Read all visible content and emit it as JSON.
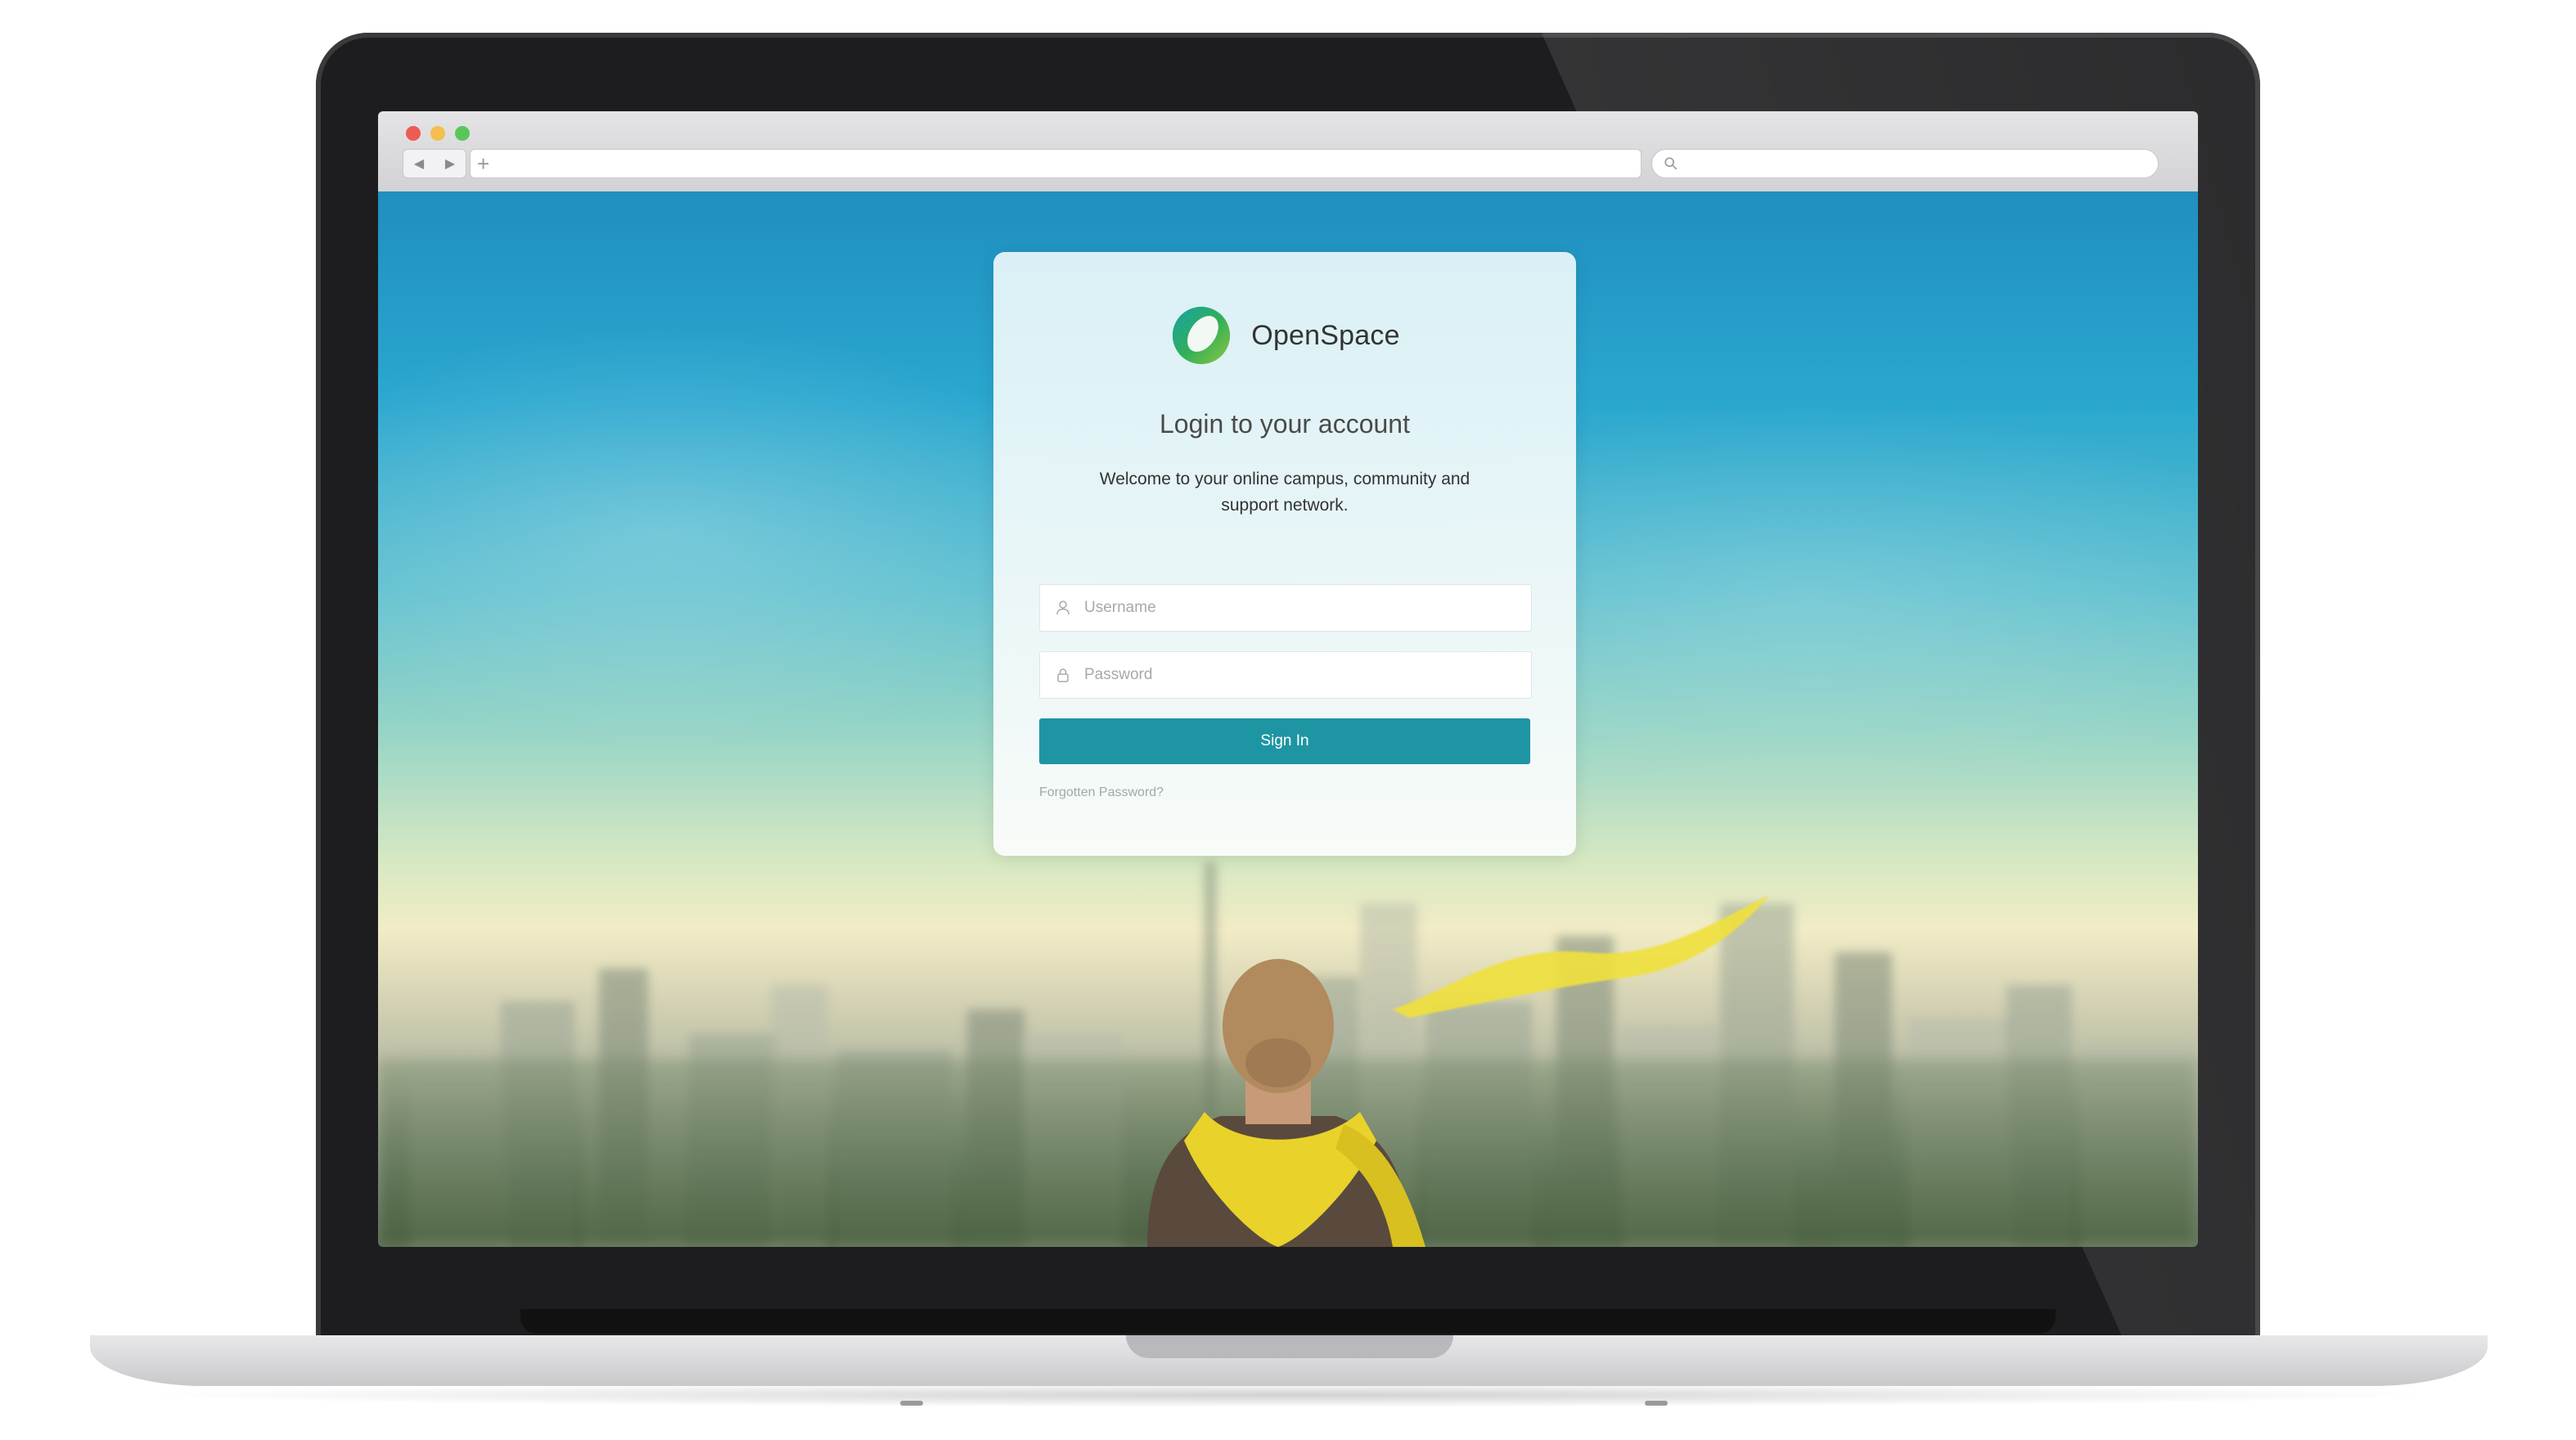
{
  "browser": {
    "nav_back_glyph": "◀",
    "nav_forward_glyph": "▶",
    "new_tab_glyph": "+",
    "url": "",
    "search_placeholder": "",
    "traffic_lights": {
      "close": "#ee5b52",
      "minimize": "#f5be4f",
      "zoom": "#5ac65a"
    }
  },
  "login": {
    "brand_name": "OpenSpace",
    "title": "Login to your account",
    "subtitle": "Welcome to your online campus, community and support network.",
    "username_placeholder": "Username",
    "password_placeholder": "Password",
    "username_value": "",
    "password_value": "",
    "signin_label": "Sign In",
    "forgot_label": "Forgotten Password?",
    "icons": {
      "logo": "openspace-ring-logo",
      "username": "user-icon",
      "password": "lock-icon",
      "search": "search-icon"
    }
  },
  "colors": {
    "accent": "#1e95a3",
    "logo_green": "#2fae5a",
    "logo_teal": "#16a3a8",
    "logo_lime": "#8cc63f"
  }
}
